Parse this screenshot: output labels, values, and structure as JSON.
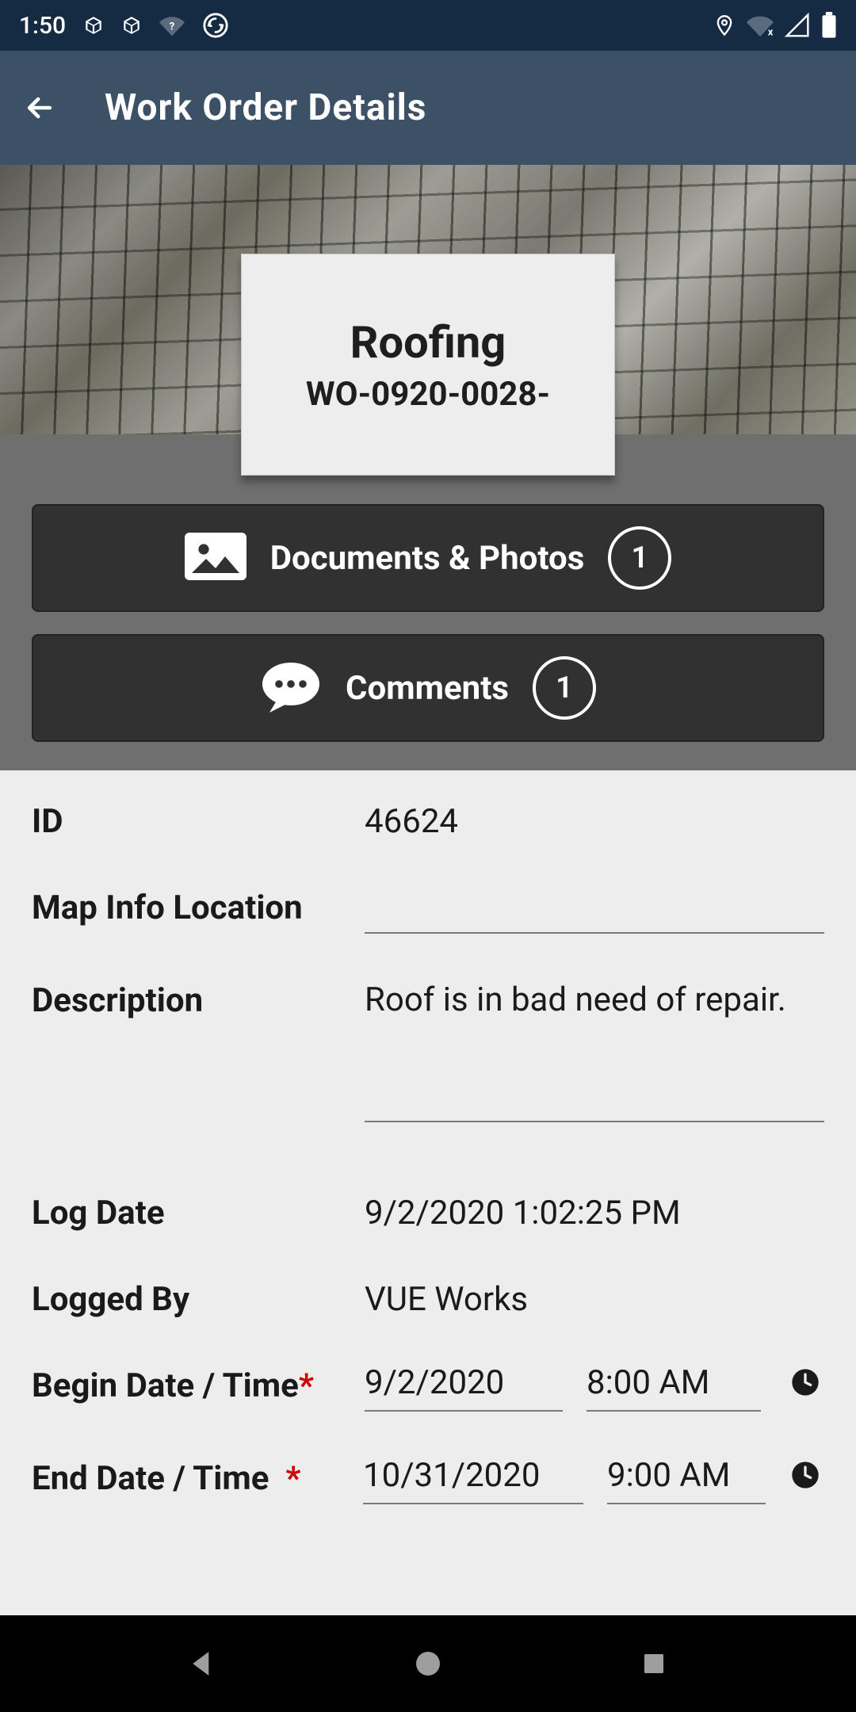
{
  "statusbar": {
    "time": "1:50"
  },
  "header": {
    "title": "Work Order Details"
  },
  "hero": {
    "category": "Roofing",
    "wo_number": "WO-0920-0028-"
  },
  "buttons": {
    "documents": {
      "label": "Documents & Photos",
      "count": "1"
    },
    "comments": {
      "label": "Comments",
      "count": "1"
    }
  },
  "fields": {
    "id": {
      "label": "ID",
      "value": "46624"
    },
    "map_loc": {
      "label": "Map Info Location",
      "value": ""
    },
    "description": {
      "label": "Description",
      "value": "Roof is in bad need of repair."
    },
    "log_date": {
      "label": "Log Date",
      "value": "9/2/2020 1:02:25 PM"
    },
    "logged_by": {
      "label": "Logged By",
      "value": "VUE Works"
    },
    "begin": {
      "label": "Begin Date / Time",
      "date": "9/2/2020",
      "time": "8:00 AM"
    },
    "end": {
      "label": "End Date / Time",
      "date": "10/31/2020",
      "time": "9:00 AM"
    }
  }
}
